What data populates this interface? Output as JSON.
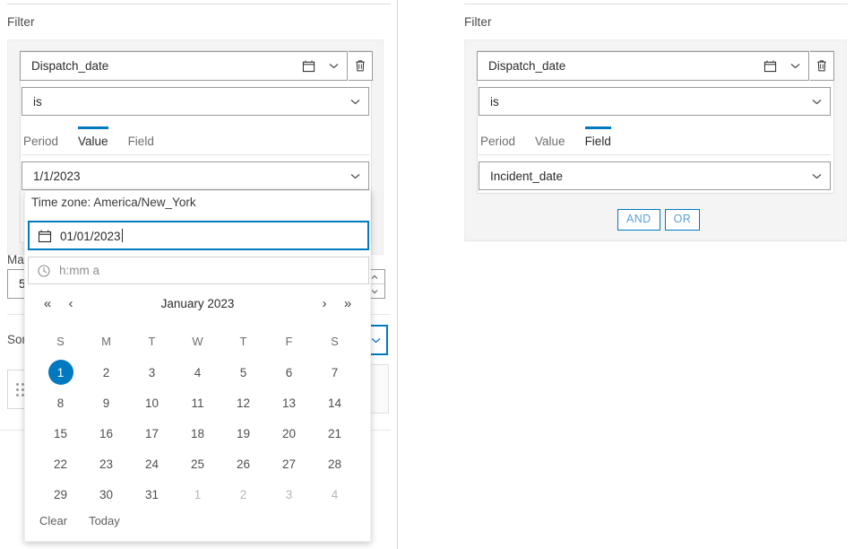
{
  "left_panel": {
    "filter_label": "Filter",
    "field_select": {
      "value": "Dispatch_date",
      "icon": "calendar-icon",
      "chevron": "chevron-down-icon"
    },
    "delete_button": {
      "icon": "trash-icon"
    },
    "operator_select": {
      "value": "is",
      "chevron": "chevron-down-icon"
    },
    "tabs": [
      {
        "label": "Period",
        "active": false
      },
      {
        "label": "Value",
        "active": true
      },
      {
        "label": "Field",
        "active": false
      }
    ],
    "value_select": {
      "value": "1/1/2023",
      "chevron": "chevron-down-icon"
    },
    "background": {
      "max_label": "Ma",
      "max_value": "5",
      "sort_label": "Sor",
      "drag_handle_icon": "drag-dots-icon"
    }
  },
  "right_panel": {
    "filter_label": "Filter",
    "field_select": {
      "value": "Dispatch_date",
      "icon": "calendar-icon",
      "chevron": "chevron-down-icon"
    },
    "delete_button": {
      "icon": "trash-icon"
    },
    "operator_select": {
      "value": "is",
      "chevron": "chevron-down-icon"
    },
    "tabs": [
      {
        "label": "Period",
        "active": false
      },
      {
        "label": "Value",
        "active": false
      },
      {
        "label": "Field",
        "active": true
      }
    ],
    "field_value_select": {
      "value": "Incident_date",
      "chevron": "chevron-down-icon"
    },
    "logic_buttons": [
      {
        "label": "AND"
      },
      {
        "label": "OR"
      }
    ]
  },
  "date_picker": {
    "timezone_note": "Time zone: America/New_York",
    "date_input": {
      "value": "01/01/2023",
      "icon": "calendar-icon",
      "focused": true
    },
    "time_input": {
      "value": "",
      "placeholder": "h:mm a",
      "icon": "clock-icon"
    },
    "nav": {
      "prev_year_icon": "double-chevron-left-icon",
      "prev_month_icon": "chevron-left-icon",
      "title": "January 2023",
      "next_month_icon": "chevron-right-icon",
      "next_year_icon": "double-chevron-right-icon"
    },
    "day_headers": [
      "S",
      "M",
      "T",
      "W",
      "T",
      "F",
      "S"
    ],
    "weeks": [
      [
        {
          "d": "1",
          "sel": true,
          "out": false
        },
        {
          "d": "2",
          "sel": false,
          "out": false
        },
        {
          "d": "3",
          "sel": false,
          "out": false
        },
        {
          "d": "4",
          "sel": false,
          "out": false
        },
        {
          "d": "5",
          "sel": false,
          "out": false
        },
        {
          "d": "6",
          "sel": false,
          "out": false
        },
        {
          "d": "7",
          "sel": false,
          "out": false
        }
      ],
      [
        {
          "d": "8",
          "sel": false,
          "out": false
        },
        {
          "d": "9",
          "sel": false,
          "out": false
        },
        {
          "d": "10",
          "sel": false,
          "out": false
        },
        {
          "d": "11",
          "sel": false,
          "out": false
        },
        {
          "d": "12",
          "sel": false,
          "out": false
        },
        {
          "d": "13",
          "sel": false,
          "out": false
        },
        {
          "d": "14",
          "sel": false,
          "out": false
        }
      ],
      [
        {
          "d": "15",
          "sel": false,
          "out": false
        },
        {
          "d": "16",
          "sel": false,
          "out": false
        },
        {
          "d": "17",
          "sel": false,
          "out": false
        },
        {
          "d": "18",
          "sel": false,
          "out": false
        },
        {
          "d": "19",
          "sel": false,
          "out": false
        },
        {
          "d": "20",
          "sel": false,
          "out": false
        },
        {
          "d": "21",
          "sel": false,
          "out": false
        }
      ],
      [
        {
          "d": "22",
          "sel": false,
          "out": false
        },
        {
          "d": "23",
          "sel": false,
          "out": false
        },
        {
          "d": "24",
          "sel": false,
          "out": false
        },
        {
          "d": "25",
          "sel": false,
          "out": false
        },
        {
          "d": "26",
          "sel": false,
          "out": false
        },
        {
          "d": "27",
          "sel": false,
          "out": false
        },
        {
          "d": "28",
          "sel": false,
          "out": false
        }
      ],
      [
        {
          "d": "29",
          "sel": false,
          "out": false
        },
        {
          "d": "30",
          "sel": false,
          "out": false
        },
        {
          "d": "31",
          "sel": false,
          "out": false
        },
        {
          "d": "1",
          "sel": false,
          "out": true
        },
        {
          "d": "2",
          "sel": false,
          "out": true
        },
        {
          "d": "3",
          "sel": false,
          "out": true
        },
        {
          "d": "4",
          "sel": false,
          "out": true
        }
      ]
    ],
    "actions": [
      {
        "label": "Clear"
      },
      {
        "label": "Today"
      }
    ]
  },
  "colors": {
    "accent": "#0079c1",
    "logic_border": "#0079c1",
    "logic_text": "#5b9fd4",
    "card_bg": "#f4f4f4",
    "border": "#9a9a9a",
    "text": "#2b2b2b",
    "muted": "#6e6e6e"
  }
}
